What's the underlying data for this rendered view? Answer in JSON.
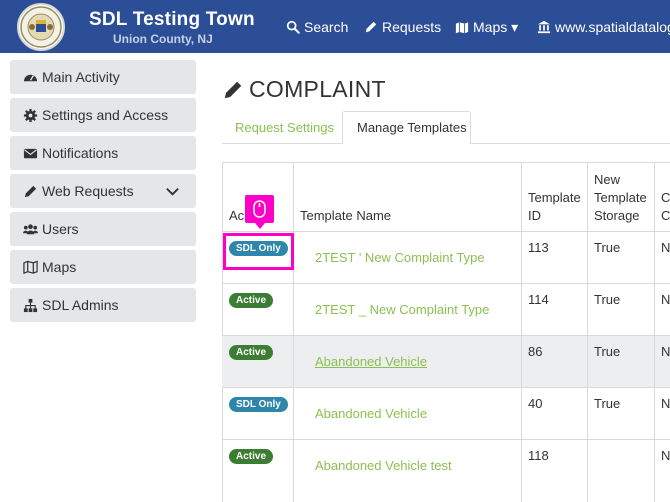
{
  "header": {
    "title": "SDL Testing Town",
    "subtitle": "Union County, NJ",
    "nav": [
      {
        "label": "Search",
        "icon": "search-icon"
      },
      {
        "label": "Requests",
        "icon": "pencil-icon"
      },
      {
        "label": "Maps ▾",
        "icon": "map-icon"
      },
      {
        "label": "www.spatialdatalogic",
        "icon": "building-icon"
      }
    ]
  },
  "sidebar": {
    "items": [
      {
        "label": "Main Activity",
        "icon": "gauge-icon"
      },
      {
        "label": "Settings and Access",
        "icon": "gear-icon"
      },
      {
        "label": "Notifications",
        "icon": "envelope-icon"
      },
      {
        "label": "Web Requests",
        "icon": "pencil-icon"
      },
      {
        "label": "Users",
        "icon": "users-icon"
      },
      {
        "label": "Maps",
        "icon": "map-icon"
      },
      {
        "label": "SDL Admins",
        "icon": "org-chart-icon"
      }
    ]
  },
  "page": {
    "title": "COMPLAINT",
    "tabs": [
      {
        "label": "Request Settings",
        "active": false
      },
      {
        "label": "Manage Templates",
        "active": true
      }
    ]
  },
  "table": {
    "headers": {
      "active": "Ac",
      "name": "Template Name",
      "id_line1": "Template",
      "id_line2": "ID",
      "storage_line1": "New",
      "storage_line2": "Template",
      "storage_line3": "Storage",
      "extra_line1": "C",
      "extra_line2": "C"
    },
    "rows": [
      {
        "status": "SDL Only",
        "name": "2TEST ' New Complaint Type",
        "id": "113",
        "storage": "True",
        "extra": "N"
      },
      {
        "status": "Active",
        "name": "2TEST _ New Complaint Type",
        "id": "114",
        "storage": "True",
        "extra": "N"
      },
      {
        "status": "Active",
        "name": "Abandoned Vehicle",
        "id": "86",
        "storage": "True",
        "extra": "N"
      },
      {
        "status": "SDL Only",
        "name": "Abandoned Vehicle",
        "id": "40",
        "storage": "True",
        "extra": "N"
      },
      {
        "status": "Active",
        "name": "Abandoned Vehicle test",
        "id": "118",
        "storage": "",
        "extra": "N"
      }
    ]
  },
  "colors": {
    "nav_bg": "#2b4e96",
    "link_green": "#8cc152",
    "badge_active": "#3b7d32",
    "badge_sdl": "#2e86ab",
    "highlight": "#ff00c8"
  }
}
